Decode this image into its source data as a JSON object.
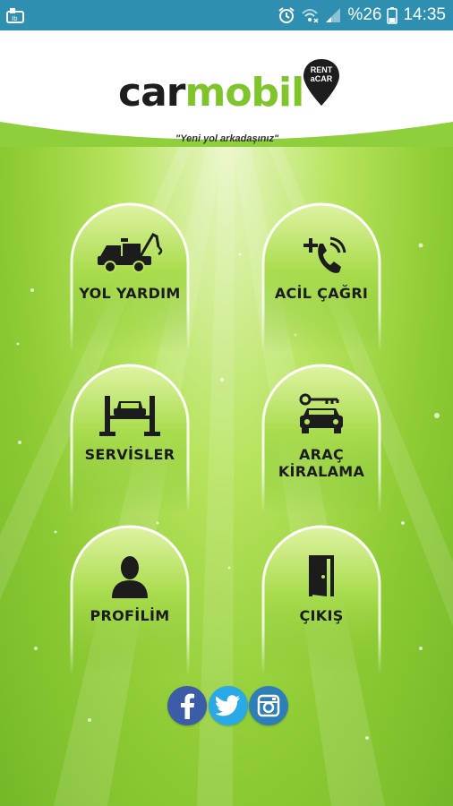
{
  "status_bar": {
    "battery": "%26",
    "time": "14:35"
  },
  "brand": {
    "name_part1": "car",
    "name_part2": "mobil",
    "badge_line1": "RENT",
    "badge_line2": "aCAR",
    "tagline": "\"Yeni yol arkadaşınız\""
  },
  "menu": [
    {
      "id": "yol-yardim",
      "label": "YOL YARDIM",
      "icon": "tow-truck-icon"
    },
    {
      "id": "acil-cagri",
      "label": "ACİL ÇAĞRI",
      "icon": "emergency-call-icon"
    },
    {
      "id": "servisler",
      "label": "SERVİSLER",
      "icon": "car-lift-icon"
    },
    {
      "id": "arac-kiralama",
      "label": "ARAÇ KİRALAMA",
      "icon": "car-key-icon"
    },
    {
      "id": "profilim",
      "label": "PROFİLİM",
      "icon": "user-icon"
    },
    {
      "id": "cikis",
      "label": "ÇIKIŞ",
      "icon": "exit-door-icon"
    }
  ],
  "social": [
    {
      "name": "facebook-icon"
    },
    {
      "name": "twitter-icon"
    },
    {
      "name": "instagram-icon"
    }
  ],
  "colors": {
    "status_bar": "#2f8fb1",
    "brand_green": "#7fc42a",
    "facebook": "#3b5da8",
    "twitter": "#29a9e6",
    "instagram": "#2e7eb8"
  }
}
